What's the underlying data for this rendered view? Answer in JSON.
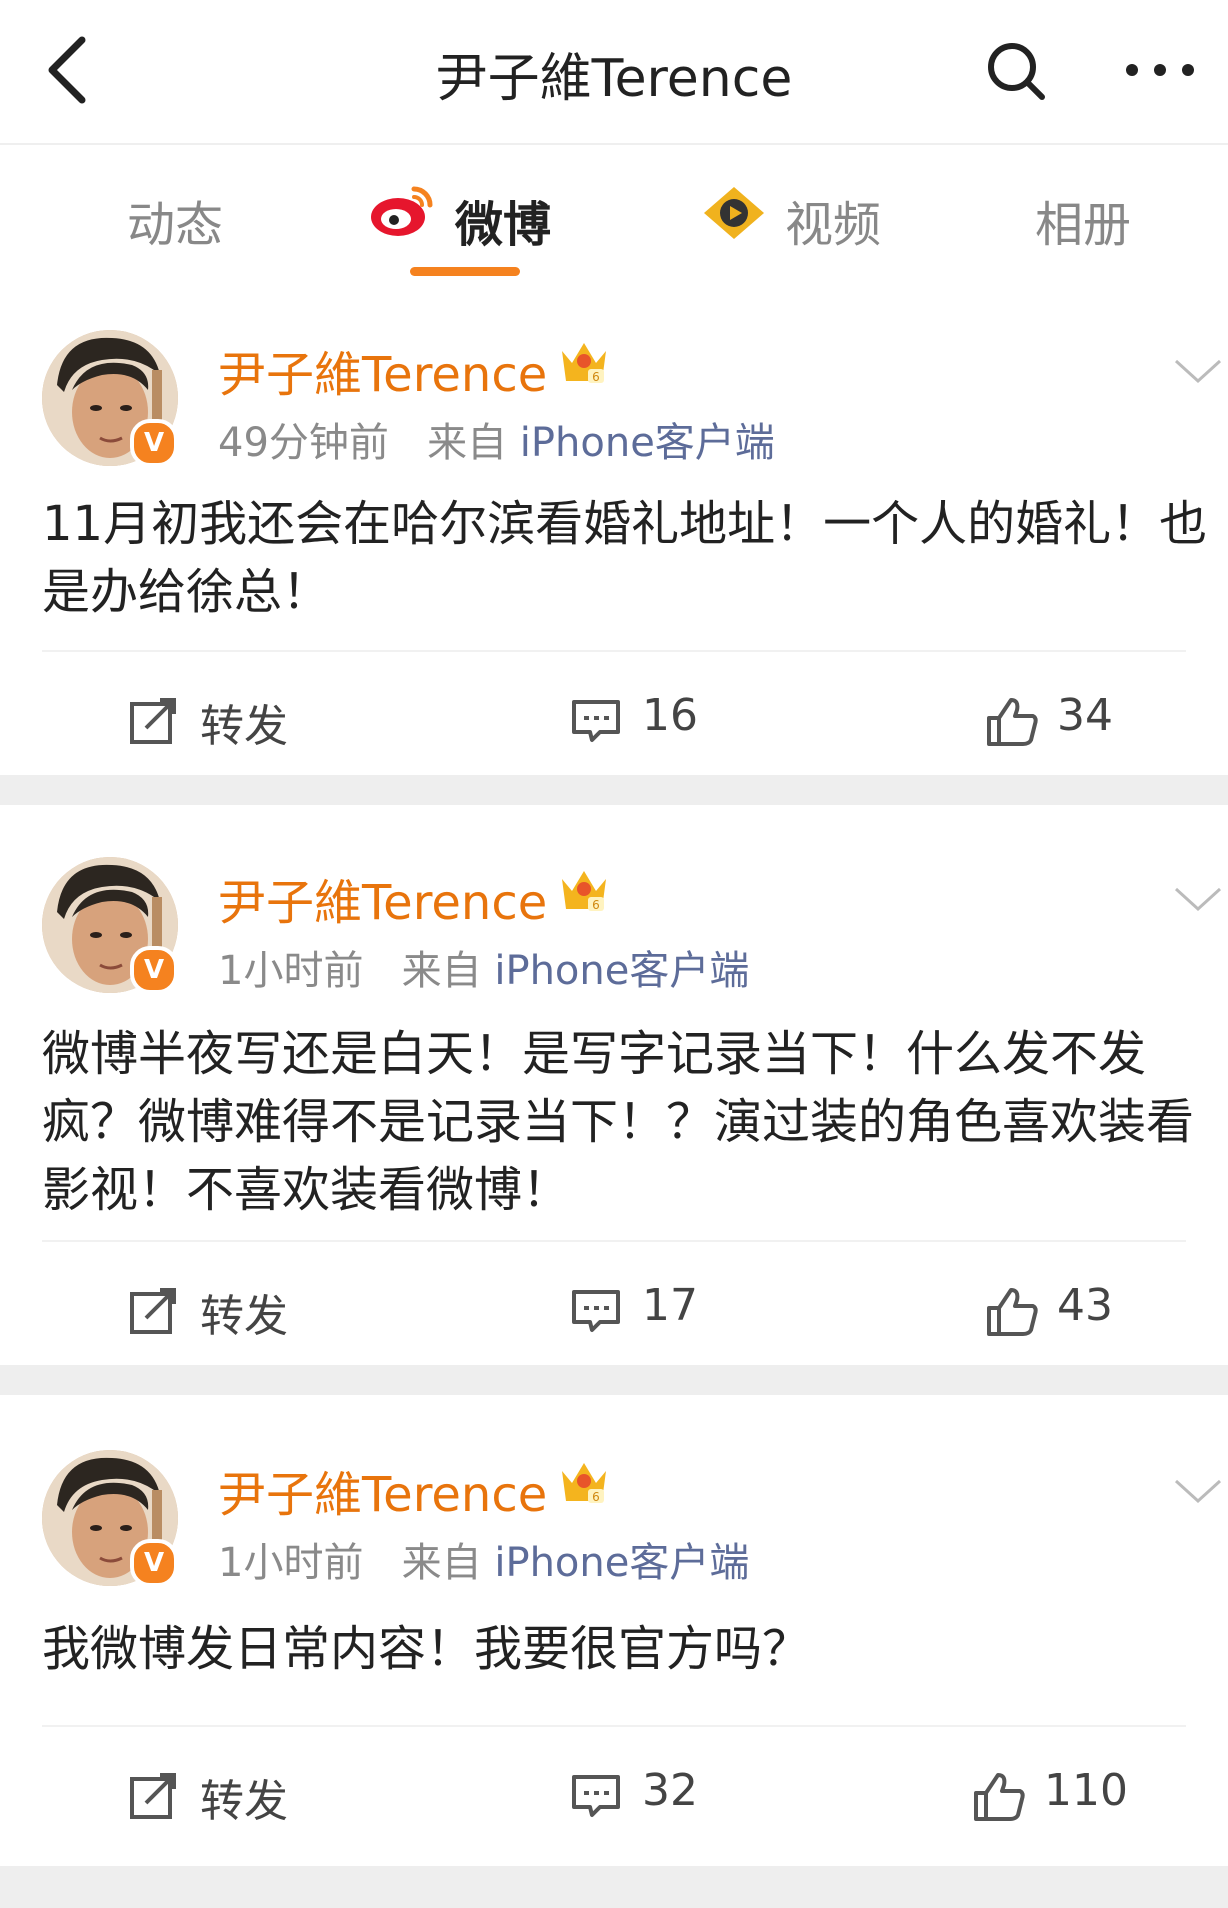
{
  "header": {
    "title": "尹子維Terence"
  },
  "tabs": [
    {
      "label": "动态"
    },
    {
      "label": "微博"
    },
    {
      "label": "视频"
    },
    {
      "label": "相册"
    }
  ],
  "posts": [
    {
      "username": "尹子維Terence",
      "time": "49分钟前",
      "source_prefix": "来自",
      "source": "iPhone客户端",
      "content": "11月初我还会在哈尔滨看婚礼地址！一个人的婚礼！也是办给徐总！",
      "repost_label": "转发",
      "comments": "16",
      "likes": "34"
    },
    {
      "username": "尹子維Terence",
      "time": "1小时前",
      "source_prefix": "来自",
      "source": "iPhone客户端",
      "content": "微博半夜写还是白天！是写字记录当下！什么发不发疯？微博难得不是记录当下！？演过装的角色喜欢装看影视！不喜欢装看微博！",
      "repost_label": "转发",
      "comments": "17",
      "likes": "43"
    },
    {
      "username": "尹子維Terence",
      "time": "1小时前",
      "source_prefix": "来自",
      "source": "iPhone客户端",
      "content": "我微博发日常内容！我要很官方吗？",
      "repost_label": "转发",
      "comments": "32",
      "likes": "110"
    }
  ],
  "verify_badge": "V",
  "colors": {
    "accent": "#f5821f",
    "username": "#e8740c",
    "source": "#5d6c99"
  }
}
